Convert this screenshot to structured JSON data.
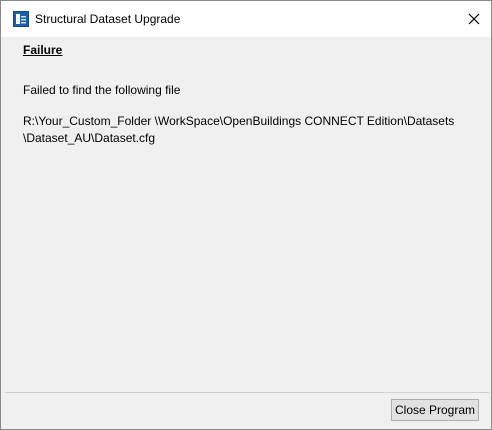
{
  "window": {
    "title": "Structural Dataset Upgrade",
    "app_icon": "structural-app-icon",
    "close_icon": "close-icon"
  },
  "content": {
    "heading": "Failure",
    "message": "Failed to find the following file",
    "path_line_1": "R:\\Your_Custom_Folder \\WorkSpace\\OpenBuildings CONNECT Edition\\Datasets",
    "path_line_2": "\\Dataset_AU\\Dataset.cfg"
  },
  "footer": {
    "close_program_label": "Close Program"
  },
  "colors": {
    "dialog_background": "#f0f0f0",
    "titlebar_background": "#ffffff",
    "button_background": "#e1e1e1",
    "button_border": "#adadad",
    "icon_blue": "#1f5fa8"
  }
}
